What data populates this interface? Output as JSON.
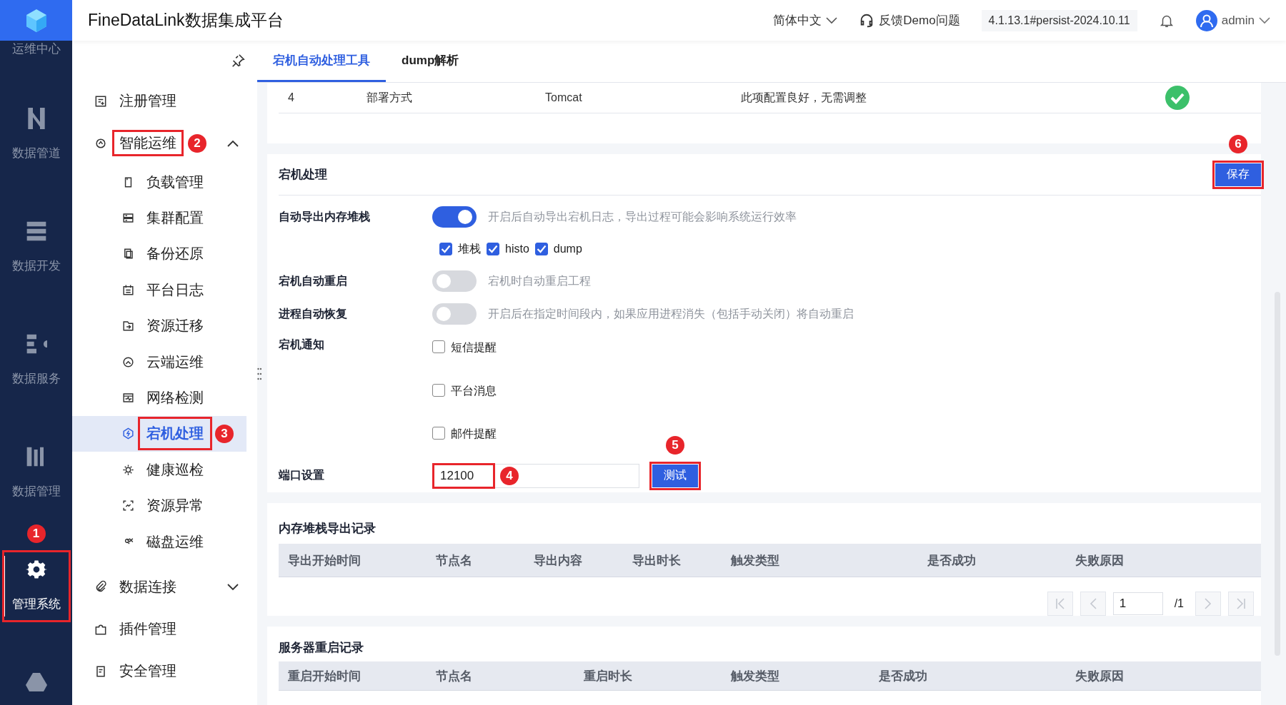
{
  "rail": {
    "items": [
      {
        "label": "运维中心",
        "selected": false
      },
      {
        "label": "数据管道",
        "selected": false
      },
      {
        "label": "数据开发",
        "selected": false
      },
      {
        "label": "数据服务",
        "selected": false
      },
      {
        "label": "数据管理",
        "selected": false
      },
      {
        "label": "管理系统",
        "selected": true,
        "callout": "1"
      }
    ]
  },
  "header": {
    "title": "FineDataLink数据集成平台",
    "language": "简体中文",
    "feedback": "反馈Demo问题",
    "version": "4.1.13.1#persist-2024.10.11",
    "user": "admin"
  },
  "sidebar": {
    "items": [
      {
        "label": "注册管理"
      },
      {
        "label": "智能运维",
        "expanded": true,
        "callout": "2",
        "children": [
          {
            "label": "负载管理",
            "selected": false
          },
          {
            "label": "集群配置",
            "selected": false
          },
          {
            "label": "备份还原",
            "selected": false
          },
          {
            "label": "平台日志",
            "selected": false
          },
          {
            "label": "资源迁移",
            "selected": false
          },
          {
            "label": "云端运维",
            "selected": false
          },
          {
            "label": "网络检测",
            "selected": false
          },
          {
            "label": "宕机处理",
            "selected": true,
            "callout": "3"
          },
          {
            "label": "健康巡检",
            "selected": false
          },
          {
            "label": "资源异常",
            "selected": false
          },
          {
            "label": "磁盘运维",
            "selected": false
          }
        ]
      },
      {
        "label": "数据连接",
        "expanded": false
      },
      {
        "label": "插件管理"
      },
      {
        "label": "安全管理"
      }
    ]
  },
  "tabs": [
    {
      "label": "宕机自动处理工具",
      "selected": true
    },
    {
      "label": "dump解析",
      "selected": false
    }
  ],
  "config_check_row": {
    "cells": [
      "4",
      "部署方式",
      "Tomcat",
      "此项配置良好，无需调整"
    ]
  },
  "crash_panel": {
    "title": "宕机处理",
    "save_button": {
      "label": "保存",
      "callout": "6"
    },
    "settings": [
      {
        "kind": "toggle",
        "label": "自动导出内存堆栈",
        "on": true,
        "hint": "开启后自动导出宕机日志，导出过程可能会影响系统运行效率",
        "options": [
          {
            "label": "堆栈",
            "checked": true
          },
          {
            "label": "histo",
            "checked": true
          },
          {
            "label": "dump",
            "checked": true
          }
        ]
      },
      {
        "kind": "toggle",
        "label": "宕机自动重启",
        "on": false,
        "hint": "宕机时自动重启工程"
      },
      {
        "kind": "toggle",
        "label": "进程自动恢复",
        "on": false,
        "hint": "开启后在指定时间段内，如果应用进程消失（包括手动关闭）将自动重启"
      },
      {
        "kind": "checklist",
        "label": "宕机通知",
        "options": [
          {
            "label": "短信提醒",
            "checked": false
          },
          {
            "label": "平台消息",
            "checked": false
          },
          {
            "label": "邮件提醒",
            "checked": false
          }
        ]
      },
      {
        "kind": "port",
        "label": "端口设置",
        "value": "12100",
        "callout": "4",
        "test_button": {
          "label": "测试",
          "callout": "5"
        }
      }
    ]
  },
  "export_records": {
    "title": "内存堆栈导出记录",
    "columns": [
      "导出开始时间",
      "节点名",
      "导出内容",
      "导出时长",
      "触发类型",
      "是否成功",
      "失败原因"
    ],
    "pagination": {
      "page": "1",
      "total": "/1"
    }
  },
  "restart_records": {
    "title": "服务器重启记录",
    "columns": [
      "重启开始时间",
      "节点名",
      "重启时长",
      "触发类型",
      "是否成功",
      "失败原因"
    ]
  }
}
